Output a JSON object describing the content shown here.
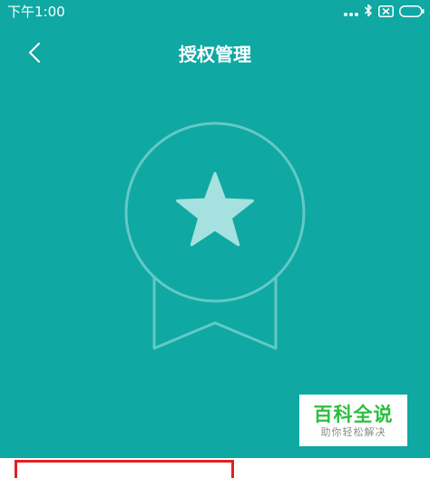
{
  "status_bar": {
    "time": "下午1:00",
    "icons": [
      "signal-dots-icon",
      "bluetooth-icon",
      "sim-icon",
      "battery-icon"
    ]
  },
  "header": {
    "title": "授权管理",
    "back_icon": "chevron-left-icon"
  },
  "badge": {
    "icon": "award-medal-icon",
    "star_icon": "star-icon"
  },
  "watermark": {
    "title": "百科全说",
    "subtitle": "助你轻松解决"
  },
  "colors": {
    "primary_background": "#0fa8a3",
    "badge_outline": "#63c9c6",
    "badge_star": "#a5e1de",
    "watermark_green": "#2bbf3e",
    "highlight_red": "#e0211f"
  }
}
